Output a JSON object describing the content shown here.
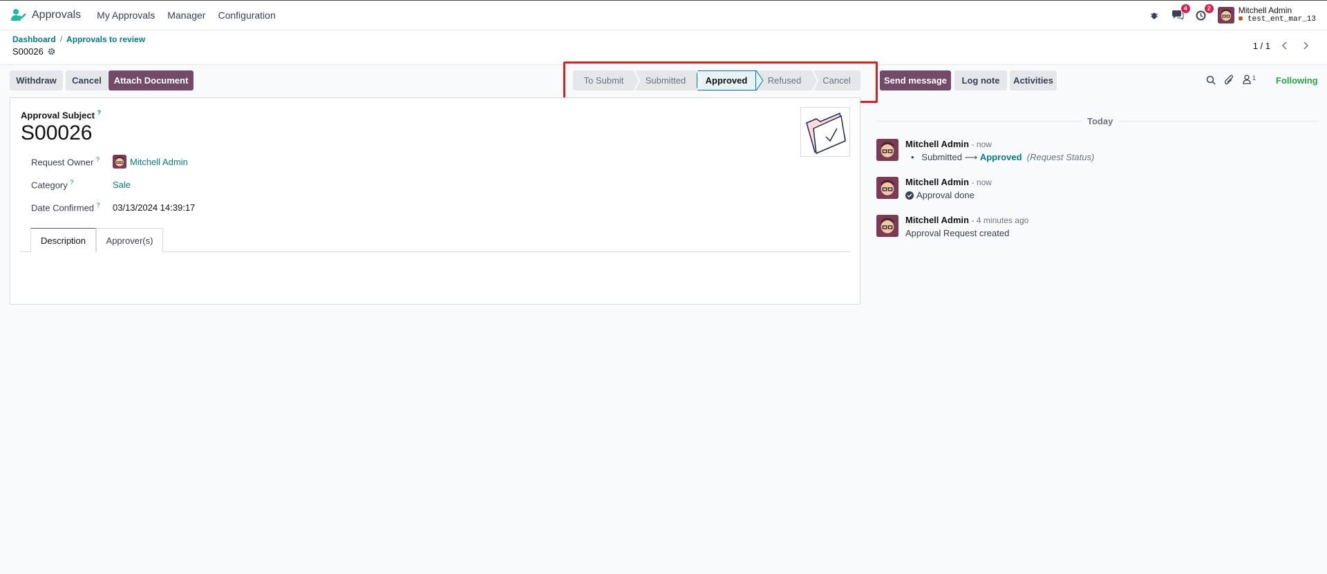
{
  "nav": {
    "app_name": "Approvals",
    "menus": [
      "My Approvals",
      "Manager",
      "Configuration"
    ],
    "chat_count": "4",
    "activity_count": "2",
    "user_name": "Mitchell Admin",
    "db_name": "test_ent_mar_13"
  },
  "breadcrumb": {
    "items": [
      "Dashboard",
      "Approvals to review"
    ],
    "separator": "/",
    "record": "S00026"
  },
  "pager": {
    "text": "1 / 1"
  },
  "actions": {
    "withdraw": "Withdraw",
    "cancel": "Cancel",
    "attach": "Attach Document"
  },
  "status": {
    "stages": [
      "To Submit",
      "Submitted",
      "Approved",
      "Refused",
      "Cancel"
    ],
    "current": "Approved"
  },
  "chatter_buttons": {
    "send": "Send message",
    "log": "Log note",
    "activities": "Activities",
    "follower_count": "1",
    "following": "Following"
  },
  "form": {
    "subject_label": "Approval Subject",
    "subject": "S00026",
    "owner_label": "Request Owner",
    "owner": "Mitchell Admin",
    "category_label": "Category",
    "category": "Sale",
    "date_label": "Date Confirmed",
    "date": "03/13/2024 14:39:17",
    "tip": "?",
    "tabs": [
      "Description",
      "Approver(s)"
    ]
  },
  "chatter": {
    "date_sep": "Today",
    "messages": [
      {
        "author": "Mitchell Admin",
        "when": "- now",
        "from": "Submitted",
        "arrow": "⟶",
        "to": "Approved",
        "field": "(Request Status)"
      },
      {
        "author": "Mitchell Admin",
        "when": "- now",
        "body": "Approval done"
      },
      {
        "author": "Mitchell Admin",
        "when": "- 4 minutes ago",
        "body": "Approval Request created"
      }
    ]
  },
  "colors": {
    "primary": "#714b67",
    "accent": "#017e84",
    "highlight": "#e11d1d"
  }
}
